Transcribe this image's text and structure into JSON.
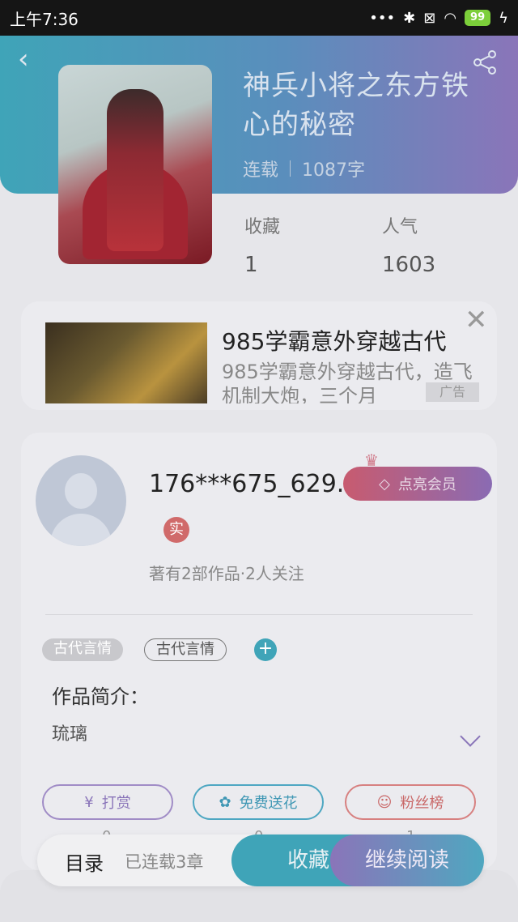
{
  "status": {
    "time": "上午7:36",
    "battery": "99"
  },
  "book": {
    "title": "神兵小将之东方铁心的秘密",
    "status": "连载",
    "words": "1087字",
    "stats": [
      {
        "label": "收藏",
        "value": "1"
      },
      {
        "label": "人气",
        "value": "1603"
      }
    ]
  },
  "ad": {
    "title": "985学霸意外穿越古代",
    "desc": "985学霸意外穿越古代，造飞机制大炮，三个月",
    "tag": "广告"
  },
  "author": {
    "name": "176***675_629...",
    "badge": "实",
    "works": "著有2部作品·2人关注",
    "vip_label": "点亮会员",
    "tags": [
      "古代言情",
      "古代言情"
    ],
    "intro_heading": "作品简介：",
    "intro_text": "琉璃"
  },
  "actions": [
    {
      "label": "打赏",
      "icon": "yen-icon",
      "count": "0"
    },
    {
      "label": "免费送花",
      "icon": "flower-icon",
      "count": "0"
    },
    {
      "label": "粉丝榜",
      "icon": "fans-icon",
      "count": "1"
    }
  ],
  "bottom": {
    "toc": "目录",
    "chapters": "已连载3章",
    "collect": "收藏",
    "read": "继续阅读"
  }
}
